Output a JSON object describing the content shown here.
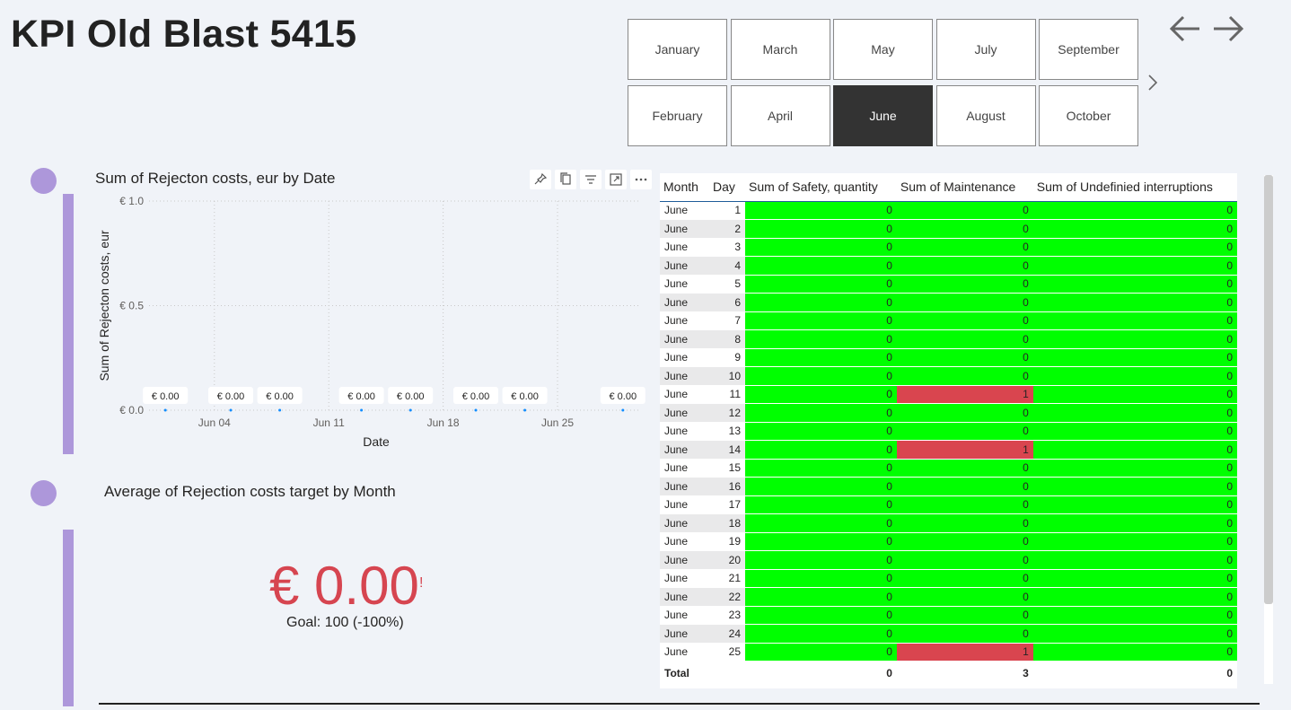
{
  "page_title": "KPI Old Blast 5415",
  "slicer": {
    "months": [
      {
        "label": "January",
        "selected": false
      },
      {
        "label": "March",
        "selected": false
      },
      {
        "label": "May",
        "selected": false
      },
      {
        "label": "July",
        "selected": false
      },
      {
        "label": "September",
        "selected": false
      },
      {
        "label": "February",
        "selected": false
      },
      {
        "label": "April",
        "selected": false
      },
      {
        "label": "June",
        "selected": true
      },
      {
        "label": "August",
        "selected": false
      },
      {
        "label": "October",
        "selected": false
      }
    ]
  },
  "nav": {
    "back_icon": "arrow-left-icon",
    "forward_icon": "arrow-right-icon"
  },
  "colors": {
    "accent": "#ad97da",
    "negative": "#d64550",
    "good": "#00ff00",
    "bad": "#d9454f"
  },
  "chart": {
    "title": "Sum of Rejecton costs, eur by Date"
  },
  "chart_data": {
    "type": "scatter",
    "title": "Sum of Rejecton costs, eur by Date",
    "xlabel": "Date",
    "ylabel": "Sum of Rejecton costs, eur",
    "x_ticks": [
      "Jun 04",
      "Jun 11",
      "Jun 18",
      "Jun 25"
    ],
    "y_ticks": [
      "€ 0.0",
      "€ 0.5",
      "€ 1.0"
    ],
    "ylim": [
      0,
      1.0
    ],
    "xlim": [
      "2023-05-31",
      "2023-06-30"
    ],
    "grid": true,
    "x": [
      "2023-06-01",
      "2023-06-05",
      "2023-06-08",
      "2023-06-13",
      "2023-06-16",
      "2023-06-20",
      "2023-06-23",
      "2023-06-29"
    ],
    "values": [
      0,
      0,
      0,
      0,
      0,
      0,
      0,
      0
    ],
    "data_labels": [
      "€ 0.00",
      "€ 0.00",
      "€ 0.00",
      "€ 0.00",
      "€ 0.00",
      "€ 0.00",
      "€ 0.00",
      "€ 0.00"
    ]
  },
  "kpi": {
    "title": "Average of Rejection costs target by Month",
    "value": "€ 0.00",
    "warning": "!",
    "goal": "Goal: 100 (-100%)"
  },
  "table": {
    "headers": [
      "Month",
      "Day",
      "Sum of Safety, quantity",
      "Sum of Maintenance",
      "Sum of Undefinied interruptions"
    ],
    "rows": [
      [
        "June",
        "1",
        "0",
        "0",
        "0"
      ],
      [
        "June",
        "2",
        "0",
        "0",
        "0"
      ],
      [
        "June",
        "3",
        "0",
        "0",
        "0"
      ],
      [
        "June",
        "4",
        "0",
        "0",
        "0"
      ],
      [
        "June",
        "5",
        "0",
        "0",
        "0"
      ],
      [
        "June",
        "6",
        "0",
        "0",
        "0"
      ],
      [
        "June",
        "7",
        "0",
        "0",
        "0"
      ],
      [
        "June",
        "8",
        "0",
        "0",
        "0"
      ],
      [
        "June",
        "9",
        "0",
        "0",
        "0"
      ],
      [
        "June",
        "10",
        "0",
        "0",
        "0"
      ],
      [
        "June",
        "11",
        "0",
        "1",
        "0"
      ],
      [
        "June",
        "12",
        "0",
        "0",
        "0"
      ],
      [
        "June",
        "13",
        "0",
        "0",
        "0"
      ],
      [
        "June",
        "14",
        "0",
        "1",
        "0"
      ],
      [
        "June",
        "15",
        "0",
        "0",
        "0"
      ],
      [
        "June",
        "16",
        "0",
        "0",
        "0"
      ],
      [
        "June",
        "17",
        "0",
        "0",
        "0"
      ],
      [
        "June",
        "18",
        "0",
        "0",
        "0"
      ],
      [
        "June",
        "19",
        "0",
        "0",
        "0"
      ],
      [
        "June",
        "20",
        "0",
        "0",
        "0"
      ],
      [
        "June",
        "21",
        "0",
        "0",
        "0"
      ],
      [
        "June",
        "22",
        "0",
        "0",
        "0"
      ],
      [
        "June",
        "23",
        "0",
        "0",
        "0"
      ],
      [
        "June",
        "24",
        "0",
        "0",
        "0"
      ],
      [
        "June",
        "25",
        "0",
        "1",
        "0"
      ]
    ],
    "total": [
      "Total",
      "",
      "0",
      "3",
      "0"
    ]
  }
}
